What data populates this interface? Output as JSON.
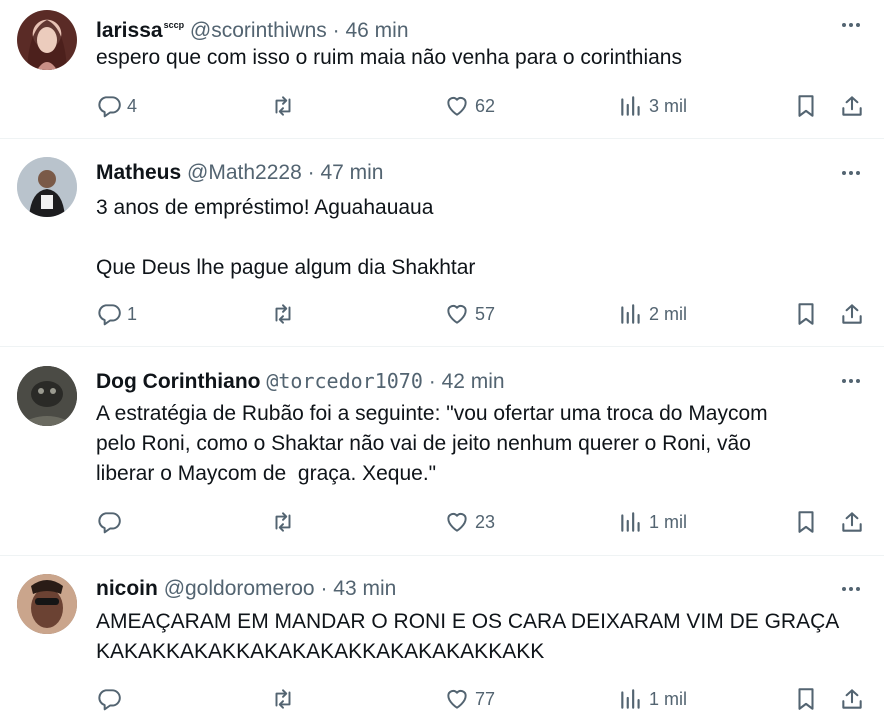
{
  "tweets": [
    {
      "name": "larissa",
      "name_badge": "sccp",
      "handle": "@scorinthiwns",
      "separator": "·",
      "time": "46 min",
      "text": "espero que com isso o ruim maia não venha para o corinthians",
      "replies": "4",
      "retweets": "",
      "likes": "62",
      "views": "3 mil"
    },
    {
      "name": "Matheus",
      "name_badge": "",
      "handle": "@Math2228",
      "separator": "·",
      "time": "47 min",
      "text": "3 anos de empréstimo! Aguahauaua\n\nQue Deus lhe pague algum dia Shakhtar",
      "replies": "1",
      "retweets": "",
      "likes": "57",
      "views": "2 mil"
    },
    {
      "name": "Dog Corinthiano",
      "name_badge": "",
      "handle": "@torcedor1070",
      "separator": "·",
      "time": "42 min",
      "text": "A estratégia de Rubão foi a seguinte: \"vou ofertar uma troca do Maycom\npelo Roni, como o Shaktar não vai de jeito nenhum querer o Roni, vão\nliberar o Maycom de  graça. Xeque.\"",
      "replies": "",
      "retweets": "",
      "likes": "23",
      "views": "1 mil"
    },
    {
      "name": "nicoin",
      "name_badge": "",
      "handle": "@goldoromeroo",
      "separator": "·",
      "time": "43 min",
      "text": "AMEAÇARAM EM MANDAR O RONI E OS CARA DEIXARAM VIM DE GRAÇA\nKAKAKKAKAKKAKAKAKAKKAKAKAKAKKAKK",
      "replies": "",
      "retweets": "",
      "likes": "77",
      "views": "1 mil"
    }
  ],
  "icons": {
    "reply": "reply-icon",
    "retweet": "retweet-icon",
    "like": "heart-icon",
    "views": "views-icon",
    "bookmark": "bookmark-icon",
    "share": "share-icon",
    "more": "more-icon"
  },
  "colors": {
    "text": "#0f1419",
    "secondary": "#536471",
    "divider": "#eff3f4"
  }
}
